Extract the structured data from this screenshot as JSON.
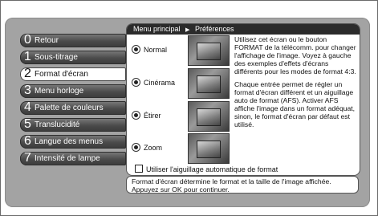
{
  "breadcrumb": {
    "root": "Menu principal",
    "separator": "▶",
    "current": "Préférences"
  },
  "menu": {
    "items": [
      {
        "num": "0",
        "label": "Retour"
      },
      {
        "num": "1",
        "label": "Sous-titrage"
      },
      {
        "num": "2",
        "label": "Format d'écran"
      },
      {
        "num": "3",
        "label": "Menu horloge"
      },
      {
        "num": "4",
        "label": "Palette de couleurs"
      },
      {
        "num": "5",
        "label": "Translucidité"
      },
      {
        "num": "6",
        "label": "Langue des menus"
      },
      {
        "num": "7",
        "label": "Intensité de lampe"
      }
    ],
    "selected_index": 2
  },
  "options": [
    {
      "label": "Normal",
      "selected": true
    },
    {
      "label": "Cinérama",
      "selected": true
    },
    {
      "label": "Étirer",
      "selected": true
    },
    {
      "label": "Zoom",
      "selected": true
    }
  ],
  "help": {
    "p1": "Utilisez cet écran ou le bouton FORMAT de la télécomm. pour changer l'affichage de l'image. Voyez à gauche des exemples d'effets d'écrans différents pour les modes de format 4:3.",
    "p2": "Chaque entrée permet de régler un format d'écran différent et un aiguillage auto de format (AFS). Activer AFS affiche l'image dans un format adéquat, sinon, le format d'écran par défaut est utilisé."
  },
  "checkbox": {
    "label": "Utiliser l'aiguillage automatique de format",
    "checked": false
  },
  "status": {
    "text": "Format d'écran détermine le format et la taille de l'image affichée. Appuyez sur OK pour continuer."
  }
}
